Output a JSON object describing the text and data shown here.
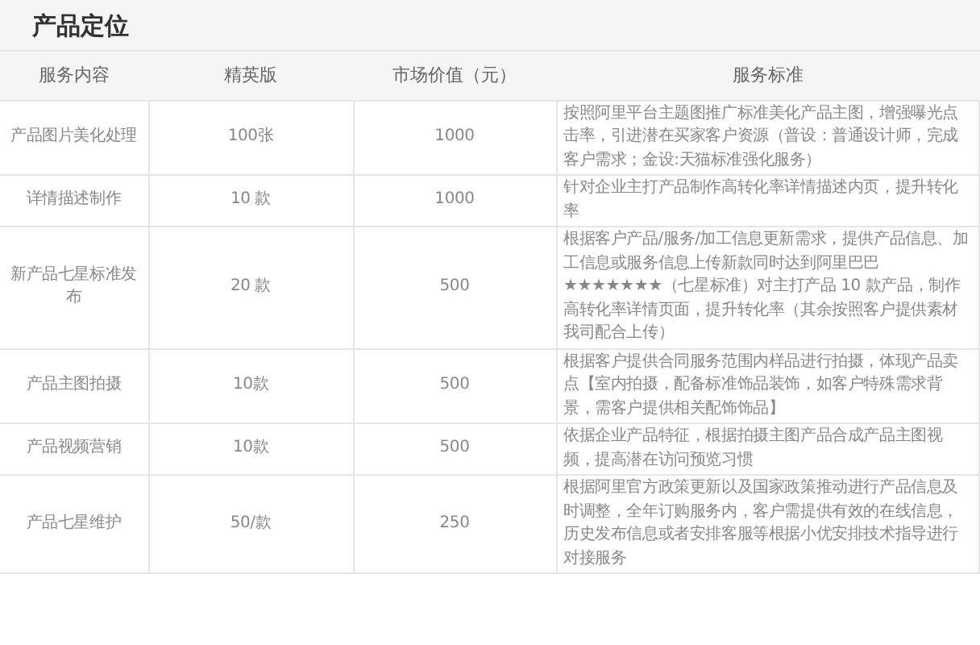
{
  "title": "产品定位",
  "table": {
    "columns": [
      "服务内容",
      "精英版",
      "市场价值（元）",
      "服务标准"
    ],
    "rows": [
      [
        "产品图片美化处理",
        "100张",
        "1000",
        "按照阿里平台主题图推广标准美化产品主图，增强曝光点击率，引进潜在买家客户资源（普设：普通设计师，完成客户需求；金设:天猫标准强化服务）"
      ],
      [
        "详情描述制作",
        "10 款",
        "1000",
        "针对企业主打产品制作高转化率详情描述内页，提升转化率"
      ],
      [
        "新产品七星标准发布",
        "20 款",
        "500",
        "根据客户产品/服务/加工信息更新需求，提供产品信息、加工信息或服务信息上传新款同时达到阿里巴巴★★★★★★★（七星标准）对主打产品 10 款产品，制作高转化率详情页面，提升转化率（其余按照客户提供素材我司配合上传）"
      ],
      [
        "产品主图拍摄",
        "10款",
        "500",
        "根据客户提供合同服务范围内样品进行拍摄，体现产品卖点【室内拍摄，配备标准饰品装饰，如客户特殊需求背景，需客户提供相关配饰饰品】"
      ],
      [
        "产品视频营销",
        "10款",
        "500",
        "依据企业产品特征，根据拍摄主图产品合成产品主图视频，提高潜在访问预览习惯"
      ],
      [
        "产品七星维护",
        "50/款",
        "250",
        "根据阿里官方政策更新以及国家政策推动进行产品信息及时调整，全年订购服务内，客户需提供有效的在线信息，历史发布信息或者安排客服等根据小优安排技术指导进行对接服务"
      ]
    ]
  }
}
